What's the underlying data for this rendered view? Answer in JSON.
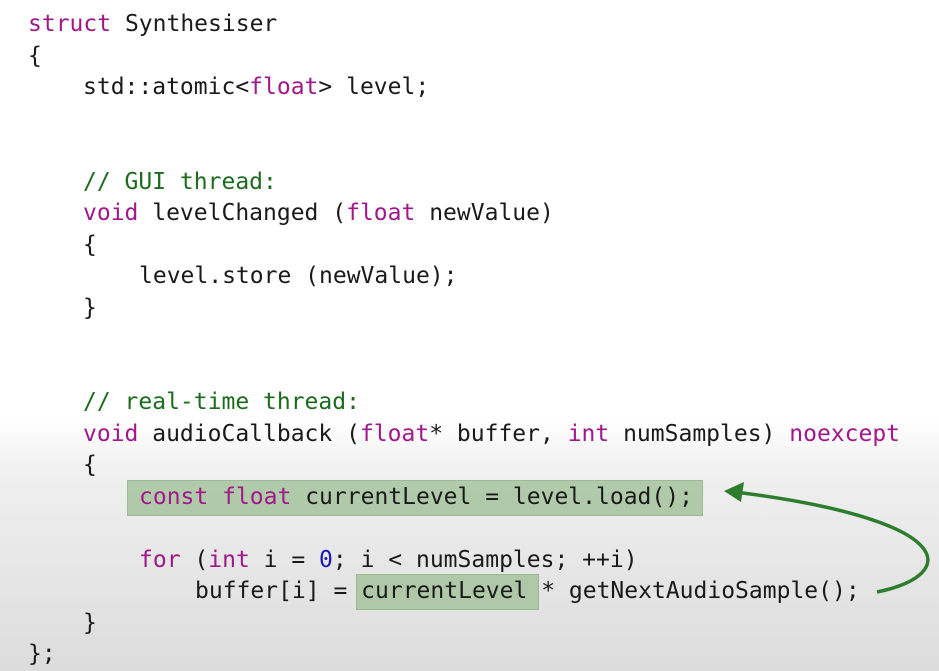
{
  "code": {
    "l1": {
      "kw": "struct",
      "rest": " Synthesiser"
    },
    "l2": {
      "text": "{"
    },
    "l3": {
      "pre": "std::atomic<",
      "kw": "float",
      "post": "> level;"
    },
    "l4": {
      "comment": "// GUI thread:"
    },
    "l5": {
      "kw1": "void",
      "mid": " levelChanged (",
      "kw2": "float",
      "post": " newValue)"
    },
    "l6": {
      "text": "{"
    },
    "l7": {
      "text": "level.store (newValue);"
    },
    "l8": {
      "text": "}"
    },
    "l9": {
      "comment": "// real-time thread:"
    },
    "l10": {
      "kw1": "void",
      "mid1": " audioCallback (",
      "kw2": "float",
      "mid2": "* buffer, ",
      "kw3": "int",
      "mid3": " numSamples) ",
      "kw4": "noexcept"
    },
    "l11": {
      "text": "{"
    },
    "l12": {
      "kw1": "const",
      "sp": " ",
      "kw2": "float",
      "post": " currentLevel = level.load();"
    },
    "l13": {
      "kw1": "for",
      "mid1": " (",
      "kw2": "int",
      "mid2": " i = ",
      "num": "0",
      "post": "; i < numSamples; ++i)"
    },
    "l14": {
      "pre": "buffer[i] = ",
      "hl": "currentLevel",
      "post": " * getNextAudioSample();"
    },
    "l15": {
      "text": "}"
    },
    "l16": {
      "text": "};"
    }
  },
  "colors": {
    "keyword": "#a0188a",
    "comment": "#1d6b1d",
    "number": "#1a1ab4",
    "highlight": "#a6c59e",
    "arrow": "#2e7d2e"
  }
}
